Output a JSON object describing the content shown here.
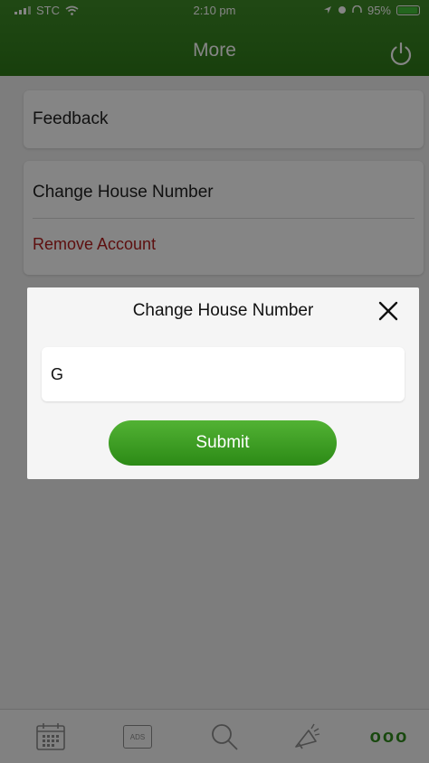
{
  "status_bar": {
    "carrier": "STC",
    "time": "2:10 pm",
    "battery": "95%",
    "battery_level": 0.95
  },
  "header": {
    "title": "More",
    "power_icon": "power-icon"
  },
  "menu": {
    "feedback": "Feedback",
    "change_house_number": "Change House Number",
    "remove_account": "Remove Account"
  },
  "modal": {
    "title": "Change House Number",
    "input_value": "G",
    "submit_label": "Submit",
    "close_icon": "close-icon"
  },
  "tabbar": {
    "items": [
      {
        "icon": "calendar-icon"
      },
      {
        "icon": "ads-icon",
        "label": "ADS"
      },
      {
        "icon": "search-icon"
      },
      {
        "icon": "megaphone-icon"
      },
      {
        "icon": "more-icon",
        "label": "ooo"
      }
    ]
  },
  "colors": {
    "brand_green": "#3f8b28",
    "remove_red": "#b21d1d",
    "more_green": "#2e8b1b"
  }
}
